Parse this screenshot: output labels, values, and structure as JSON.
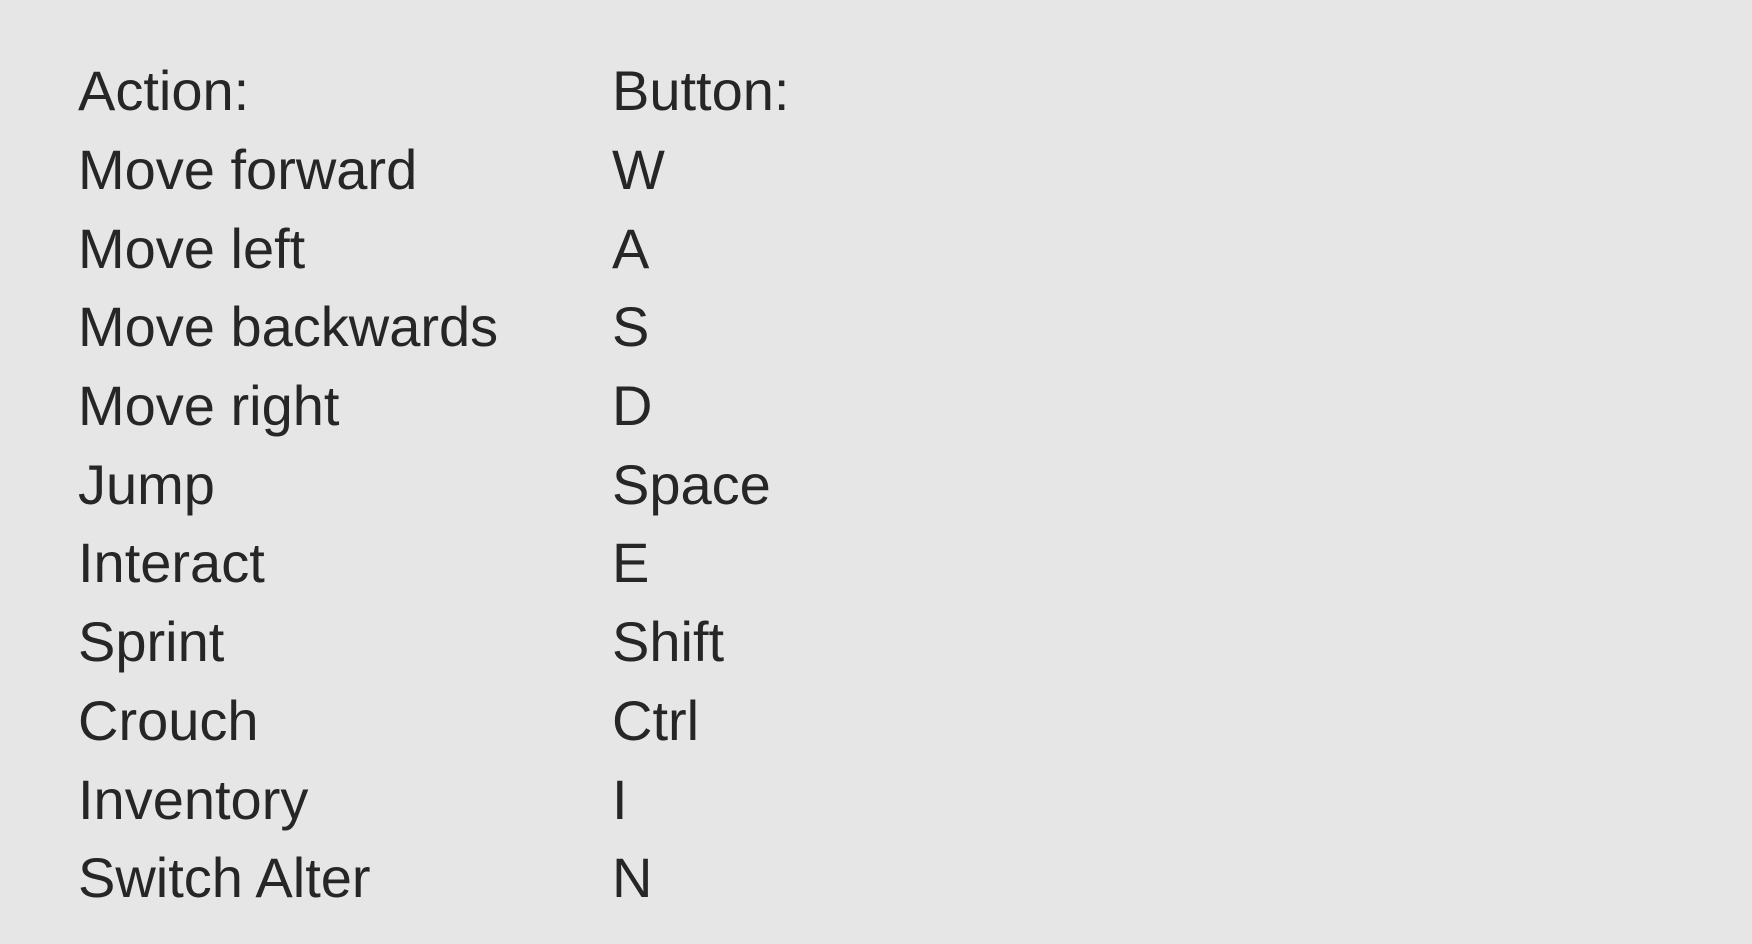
{
  "headers": {
    "action": "Action:",
    "button": "Button:"
  },
  "bindings": [
    {
      "action": "Move forward",
      "button": "W"
    },
    {
      "action": "Move left",
      "button": "A"
    },
    {
      "action": "Move backwards",
      "button": "S"
    },
    {
      "action": "Move right",
      "button": "D"
    },
    {
      "action": "Jump",
      "button": "Space"
    },
    {
      "action": "Interact",
      "button": "E"
    },
    {
      "action": "Sprint",
      "button": "Shift"
    },
    {
      "action": "Crouch",
      "button": "Ctrl"
    },
    {
      "action": "Inventory",
      "button": "I"
    },
    {
      "action": "Switch Alter",
      "button": "N"
    }
  ]
}
